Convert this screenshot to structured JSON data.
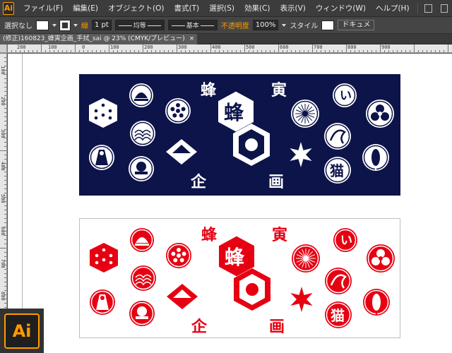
{
  "app": {
    "logo_text": "Ai",
    "badge_text": "Ai"
  },
  "menu": {
    "items": [
      "ファイル(F)",
      "編集(E)",
      "オブジェクト(O)",
      "書式(T)",
      "選択(S)",
      "効果(C)",
      "表示(V)",
      "ウィンドウ(W)",
      "ヘルプ(H)"
    ]
  },
  "control_bar": {
    "selection_label": "選択なし",
    "stroke_label": "線",
    "stroke_weight": "1 pt",
    "stroke_profile": "均等",
    "brush_label": "基本",
    "opacity_label": "不透明度",
    "opacity_value": "100%",
    "style_label": "スタイル",
    "document_button": "ドキュメ"
  },
  "document_tab": {
    "title": "(修正)160823_蜂寅企画_手拭_sai @ 23% (CMYK/プレビュー)",
    "close": "×"
  },
  "ruler": {
    "top_labels": [
      "200",
      "100",
      "0",
      "100",
      "200",
      "300",
      "400",
      "500",
      "600",
      "700",
      "800",
      "900"
    ],
    "left_labels": [
      "100",
      "200",
      "300",
      "400",
      "500",
      "600",
      "700",
      "800"
    ]
  },
  "artwork": {
    "title_chars": [
      "蜂",
      "寅",
      "企",
      "画"
    ],
    "center_char": "蜂",
    "crest_chars": {
      "i": "い",
      "neko": "猫"
    },
    "navy_color": "#0d1449",
    "red_color": "#e60012",
    "white_color": "#ffffff"
  }
}
